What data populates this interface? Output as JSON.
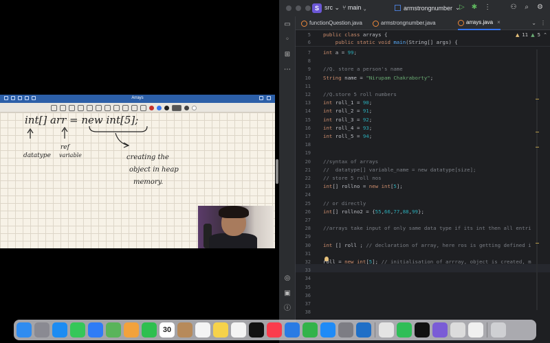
{
  "notes": {
    "title": "Arrays",
    "colors": [
      "#c4302b",
      "#3574f0",
      "#222222",
      "#ffffff"
    ],
    "handwriting": {
      "line1": "int[]   arr  =  new int[5];",
      "datatype": "datatype",
      "ref": "ref",
      "variable": "variable",
      "creating": "creating the",
      "object": "object in heap",
      "memory": "memory."
    }
  },
  "ide": {
    "project_badge": "S",
    "project_name": "src",
    "branch": "main",
    "run_config": "armstrongnumber",
    "tabs": [
      {
        "label": "functionQuestion.java",
        "active": false
      },
      {
        "label": "armstrongnumber.java",
        "active": false
      },
      {
        "label": "arrays.java",
        "active": true
      }
    ],
    "inspections": {
      "warnings": "11",
      "weak": "5"
    },
    "sticky": [
      {
        "ln": "5",
        "text": "public class arrays {"
      },
      {
        "ln": "6",
        "text": "    public static void main(String[] args) {"
      }
    ],
    "lines": [
      {
        "ln": "7",
        "text": "int a = 99;"
      },
      {
        "ln": "8",
        "text": ""
      },
      {
        "ln": "9",
        "text": "//Q. store a person's name"
      },
      {
        "ln": "10",
        "text": "String name = \"Nirupam Chakraborty\";"
      },
      {
        "ln": "11",
        "text": ""
      },
      {
        "ln": "12",
        "text": "//Q.store 5 roll numbers"
      },
      {
        "ln": "13",
        "text": "int roll_1 = 90;"
      },
      {
        "ln": "14",
        "text": "int roll_2 = 91;"
      },
      {
        "ln": "15",
        "text": "int roll_3 = 92;"
      },
      {
        "ln": "16",
        "text": "int roll_4 = 93;"
      },
      {
        "ln": "17",
        "text": "int roll_5 = 94;"
      },
      {
        "ln": "18",
        "text": ""
      },
      {
        "ln": "19",
        "text": ""
      },
      {
        "ln": "20",
        "text": "//syntax of arrays"
      },
      {
        "ln": "21",
        "text": "//  datatype[] variable_name = new datatype[size];"
      },
      {
        "ln": "22",
        "text": "// store 5 roll nos"
      },
      {
        "ln": "23",
        "text": "int[] rollno = new int[5];"
      },
      {
        "ln": "24",
        "text": ""
      },
      {
        "ln": "25",
        "text": "// or directly"
      },
      {
        "ln": "26",
        "text": "int[] rollno2 = {55,66,77,88,99};"
      },
      {
        "ln": "27",
        "text": ""
      },
      {
        "ln": "28",
        "text": "//arrays take input of only same data type if its int then all entri"
      },
      {
        "ln": "29",
        "text": ""
      },
      {
        "ln": "30",
        "text": "int [] roll ; // declaration of array, here ros is getting defined i"
      },
      {
        "ln": "31",
        "text": ""
      },
      {
        "ln": "32",
        "text": "roll = new int[5]; // initialisation of arrray, object is created, m"
      },
      {
        "ln": "33",
        "text": ""
      },
      {
        "ln": "34",
        "text": ""
      },
      {
        "ln": "35",
        "text": ""
      },
      {
        "ln": "36",
        "text": ""
      },
      {
        "ln": "37",
        "text": ""
      },
      {
        "ln": "38",
        "text": ""
      }
    ]
  },
  "dock": {
    "calendar_day": "30",
    "apps": [
      "finder-icon",
      "launchpad-icon",
      "safari-icon",
      "messages-icon",
      "mail-icon",
      "maps-icon",
      "photos-icon",
      "facetime-icon",
      "calendar-icon",
      "contacts-icon",
      "reminders-icon",
      "notes-icon",
      "freeform-icon",
      "tv-icon",
      "music-icon",
      "keynote-icon",
      "numbers-icon",
      "appstore-icon",
      "settings-icon",
      "vscode-icon",
      "chrome-icon",
      "whatsapp-icon",
      "intellij-icon",
      "github-icon",
      "preview-icon",
      "screens-icon",
      "trash-icon"
    ]
  }
}
